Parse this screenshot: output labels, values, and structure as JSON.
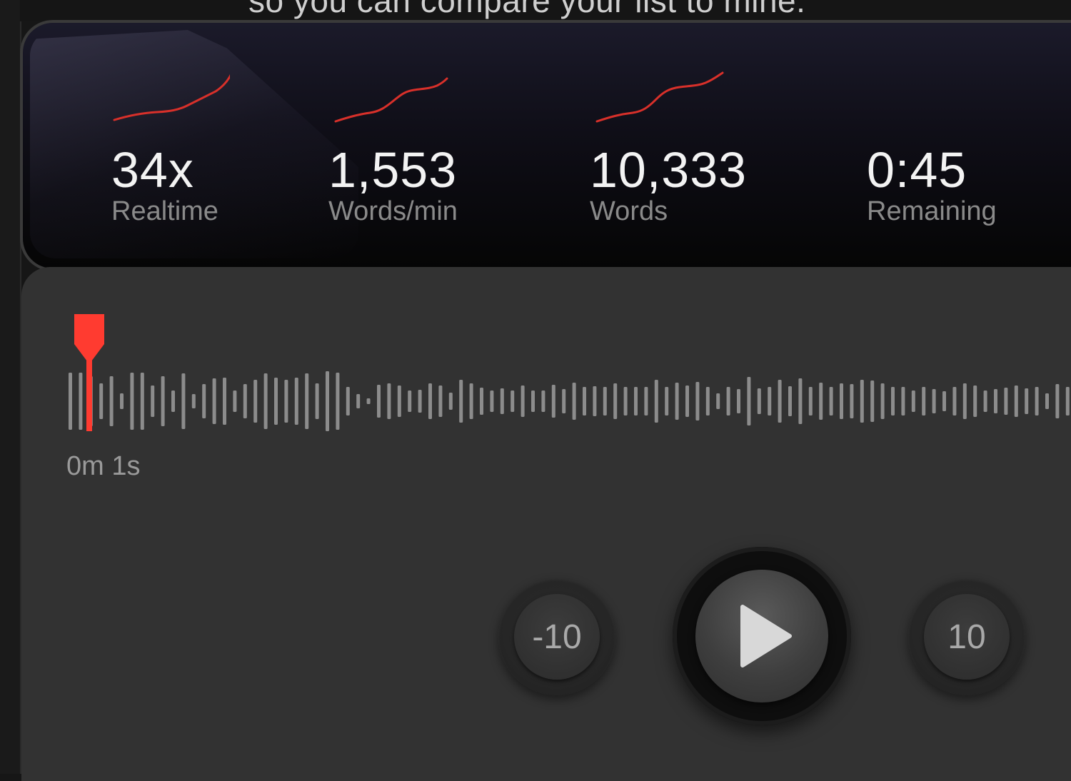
{
  "header": {
    "caption": "so you can compare your list to mine."
  },
  "stats": [
    {
      "value": "34x",
      "label": "Realtime"
    },
    {
      "value": "1,553",
      "label": "Words/min"
    },
    {
      "value": "10,333",
      "label": "Words"
    },
    {
      "value": "0:45",
      "label": "Remaining"
    }
  ],
  "colors": {
    "accent": "#ff3b30",
    "sparkline": "#d8302a",
    "waveform": "#8c8c8c"
  },
  "player": {
    "current_time": "0m 1s",
    "skip_back_label": "-10",
    "skip_forward_label": "10",
    "play_icon": "play-icon"
  }
}
